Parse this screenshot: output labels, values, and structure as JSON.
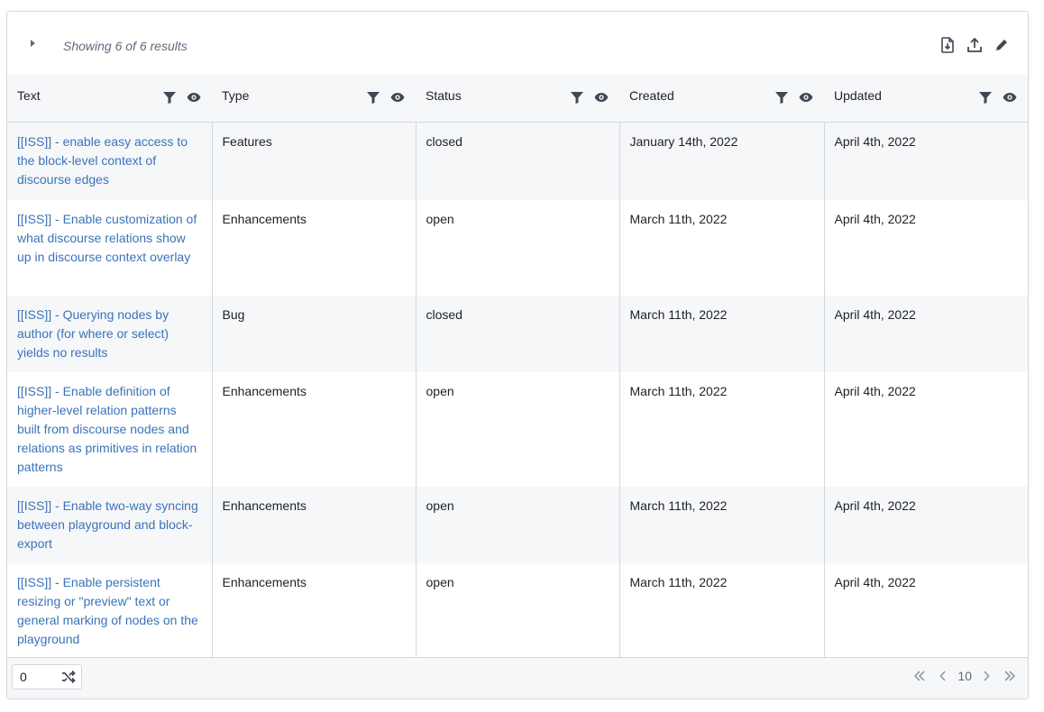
{
  "header": {
    "showing_text": "Showing 6 of 6 results",
    "actions": [
      "export-file-icon",
      "upload-icon",
      "edit-icon"
    ]
  },
  "table": {
    "columns": [
      {
        "label": "Text"
      },
      {
        "label": "Type"
      },
      {
        "label": "Status"
      },
      {
        "label": "Created"
      },
      {
        "label": "Updated"
      }
    ],
    "rows": [
      {
        "text": "[[ISS]] - enable easy access to the block-level context of discourse edges",
        "type": "Features",
        "status": "closed",
        "created": "January 14th, 2022",
        "updated": "April 4th, 2022"
      },
      {
        "text": "[[ISS]] - Enable customization of what discourse relations show up in discourse context overlay",
        "type": "Enhancements",
        "status": "open",
        "created": "March 11th, 2022",
        "updated": "April 4th, 2022"
      },
      {
        "text": "[[ISS]] - Querying nodes by author (for where or select) yields no results",
        "type": "Bug",
        "status": "closed",
        "created": "March 11th, 2022",
        "updated": "April 4th, 2022"
      },
      {
        "text": "[[ISS]] - Enable definition of higher-level relation patterns built from discourse nodes and relations as primitives in relation patterns",
        "type": "Enhancements",
        "status": "open",
        "created": "March 11th, 2022",
        "updated": "April 4th, 2022"
      },
      {
        "text": "[[ISS]] - Enable two-way syncing between playground and block-export",
        "type": "Enhancements",
        "status": "open",
        "created": "March 11th, 2022",
        "updated": "April 4th, 2022"
      },
      {
        "text": "[[ISS]] - Enable persistent resizing or \"preview\" text or general marking of nodes on the playground",
        "type": "Enhancements",
        "status": "open",
        "created": "March 11th, 2022",
        "updated": "April 4th, 2022"
      }
    ]
  },
  "footer": {
    "random_value": "0",
    "page_size": "10"
  },
  "colors": {
    "link": "#3b73b9",
    "header_bg": "#f6f7f9",
    "border": "#d3d8de"
  }
}
